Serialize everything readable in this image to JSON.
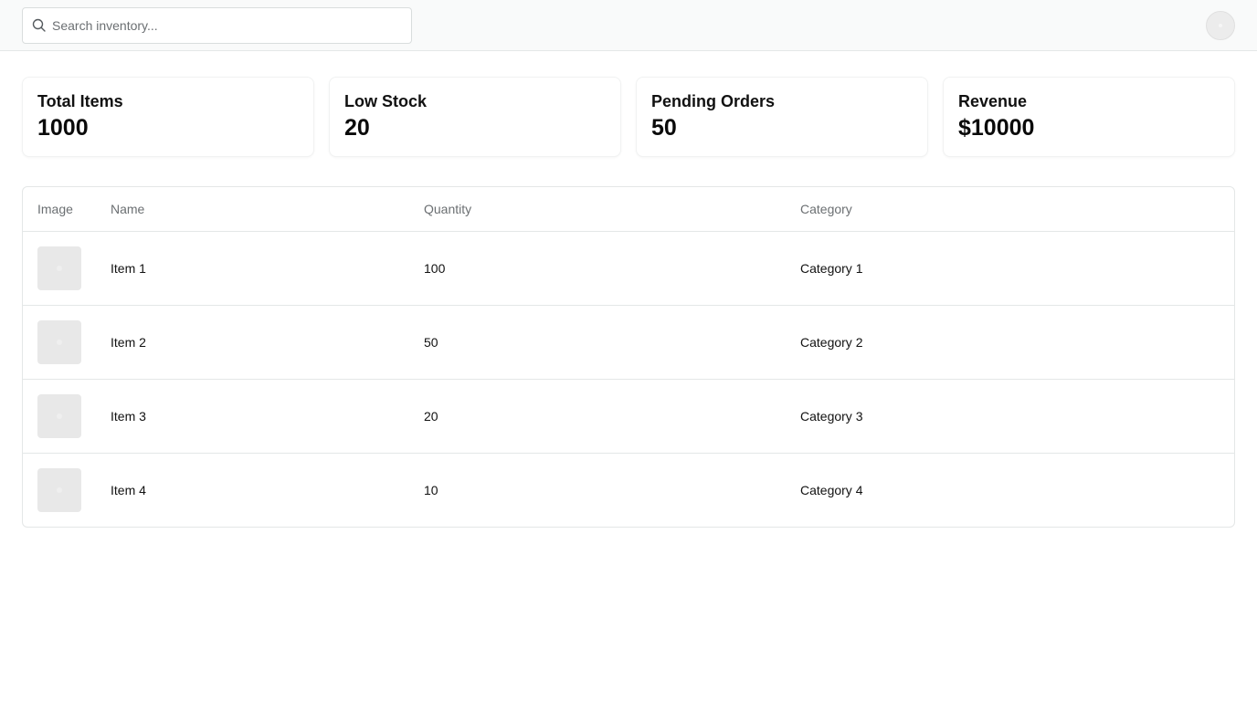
{
  "header": {
    "search": {
      "placeholder": "Search inventory...",
      "value": ""
    }
  },
  "stats": [
    {
      "label": "Total Items",
      "value": "1000"
    },
    {
      "label": "Low Stock",
      "value": "20"
    },
    {
      "label": "Pending Orders",
      "value": "50"
    },
    {
      "label": "Revenue",
      "value": "$10000"
    }
  ],
  "table": {
    "columns": [
      "Image",
      "Name",
      "Quantity",
      "Category"
    ],
    "rows": [
      {
        "name": "Item 1",
        "quantity": "100",
        "category": "Category 1"
      },
      {
        "name": "Item 2",
        "quantity": "50",
        "category": "Category 2"
      },
      {
        "name": "Item 3",
        "quantity": "20",
        "category": "Category 3"
      },
      {
        "name": "Item 4",
        "quantity": "10",
        "category": "Category 4"
      }
    ]
  },
  "icons": {
    "search": "search-icon",
    "avatar": "user-avatar",
    "thumbnail": "image-placeholder-icon"
  },
  "colors": {
    "topbar_bg": "#f9fafa",
    "border": "#e4e7e7",
    "muted_text": "#6b6f72",
    "thumbnail_bg": "#e8e8e8"
  }
}
